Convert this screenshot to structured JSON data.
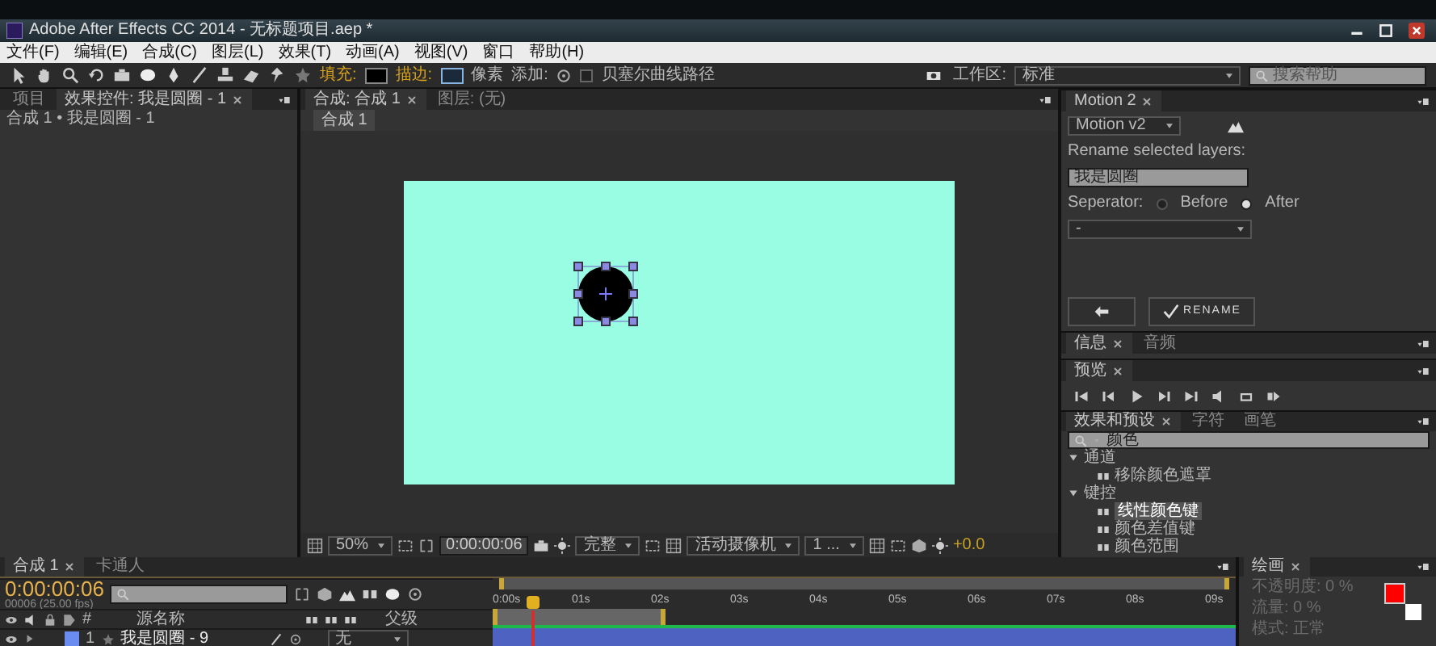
{
  "window": {
    "title": "Adobe After Effects CC 2014 - 无标题项目.aep *"
  },
  "menu": [
    "文件(F)",
    "编辑(E)",
    "合成(C)",
    "图层(L)",
    "效果(T)",
    "动画(A)",
    "视图(V)",
    "窗口",
    "帮助(H)"
  ],
  "toolbar": {
    "fill_label": "填充:",
    "stroke_label": "描边:",
    "stroke_unit": "像素",
    "add_label": "添加:",
    "bezier": {
      "label": "贝塞尔曲线路径",
      "checked": false
    },
    "workspace_label": "工作区:",
    "workspace": "标准",
    "search_placeholder": "搜索帮助"
  },
  "project_panel": {
    "tabs": [
      {
        "label": "项目",
        "selected": false
      },
      {
        "label": "效果控件: 我是圆圈 - 1",
        "selected": true
      }
    ],
    "subtitle": "合成 1 • 我是圆圈 - 1"
  },
  "viewer": {
    "tabs": [
      {
        "label": "合成: 合成 1",
        "selected": true
      },
      {
        "label": "图层: (无)",
        "selected": false
      }
    ],
    "breadcrumb": "合成 1",
    "zoom": "50%",
    "timecode": "0:00:00:06",
    "resolution": "完整",
    "camera": "活动摄像机",
    "views": "1 ...",
    "exposure": "+0.0"
  },
  "motion": {
    "tabs": [
      {
        "label": "Motion 2",
        "selected": true
      }
    ],
    "preset": "Motion v2",
    "rename_label": "Rename selected layers:",
    "rename_value": "我是圆圈",
    "separator_label": "Seperator:",
    "options": [
      {
        "label": "Before",
        "selected": false
      },
      {
        "label": "After",
        "selected": true
      }
    ],
    "separator": "-",
    "rename_button": "RENAME"
  },
  "info": {
    "tabs": [
      {
        "label": "信息",
        "selected": true
      },
      {
        "label": "音频",
        "selected": false
      }
    ]
  },
  "preview": {
    "tabs": [
      {
        "label": "预览",
        "selected": true
      }
    ]
  },
  "effects": {
    "tabs": [
      {
        "label": "效果和预设",
        "selected": true
      },
      {
        "label": "字符",
        "selected": false
      },
      {
        "label": "画笔",
        "selected": false
      }
    ],
    "search": "颜色",
    "tree": [
      {
        "label": "通道",
        "expanded": true,
        "children": [
          {
            "label": "移除颜色遮罩",
            "selected": false
          }
        ]
      },
      {
        "label": "键控",
        "expanded": true,
        "children": [
          {
            "label": "线性颜色键",
            "selected": true
          },
          {
            "label": "颜色差值键",
            "selected": false
          },
          {
            "label": "颜色范围",
            "selected": false
          }
        ]
      }
    ]
  },
  "timeline": {
    "tabs": [
      {
        "label": "合成 1",
        "selected": true
      },
      {
        "label": "卡通人",
        "selected": false
      }
    ],
    "timecode": "0:00:00:06",
    "frame_info": "00006 (25.00 fps)",
    "columns": [
      "#",
      "源名称",
      "父级"
    ],
    "layers": [
      {
        "number": "1",
        "name": "我是圆圈 - 9",
        "parent": "无",
        "color": "#6a8cf0"
      }
    ],
    "ruler": [
      "0:00s",
      "01s",
      "02s",
      "03s",
      "04s",
      "05s",
      "06s",
      "07s",
      "08s",
      "09s"
    ]
  },
  "paint": {
    "tabs": [
      {
        "label": "绘画",
        "selected": true
      }
    ],
    "opacity": "不透明度: 0 %",
    "flow": "流量: 0 %",
    "mode": "模式: 正常"
  }
}
